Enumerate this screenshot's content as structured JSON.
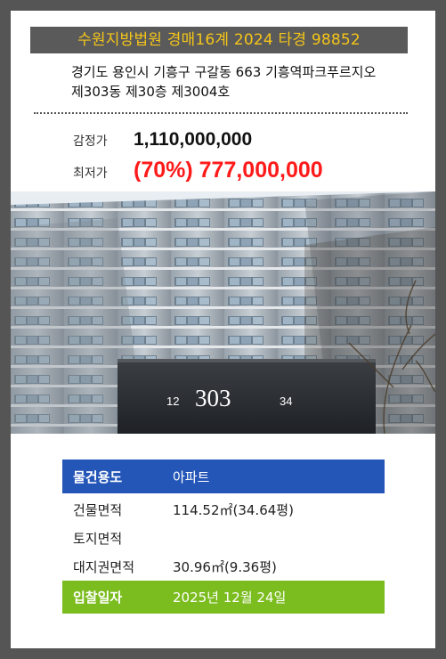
{
  "colors": {
    "frame": "#555555",
    "title_bg": "#5a5a5a",
    "title_text": "#f5c518",
    "min_price": "#ff1a1a",
    "usage_row": "#2456b8",
    "bid_row": "#7bbc1e"
  },
  "header": {
    "title": "수원지방법원 경매16계 2024 타경 98852"
  },
  "address": {
    "line1": "경기도 용인시 기흥구 구갈동 663 기흥역파크푸르지오",
    "line2": "제303동 제30층 제3004호"
  },
  "prices": {
    "appraisal_label": "감정가",
    "appraisal_value": "1,110,000,000",
    "minimum_label": "최저가",
    "minimum_value": "(70%) 777,000,000"
  },
  "photo": {
    "icon": "apartment-building-photo",
    "sign_left": "12",
    "sign_number": "303",
    "sign_right": "34"
  },
  "details": {
    "usage_label": "물건용도",
    "usage_value": "아파트",
    "building_area_label": "건물면적",
    "building_area_value": "114.52㎡(34.64평)",
    "land_area_label": "토지면적",
    "land_area_value": "",
    "land_right_area_label": "대지권면적",
    "land_right_area_value": "30.96㎡(9.36평)",
    "bid_date_label": "입찰일자",
    "bid_date_value": "2025년 12월 24일"
  }
}
